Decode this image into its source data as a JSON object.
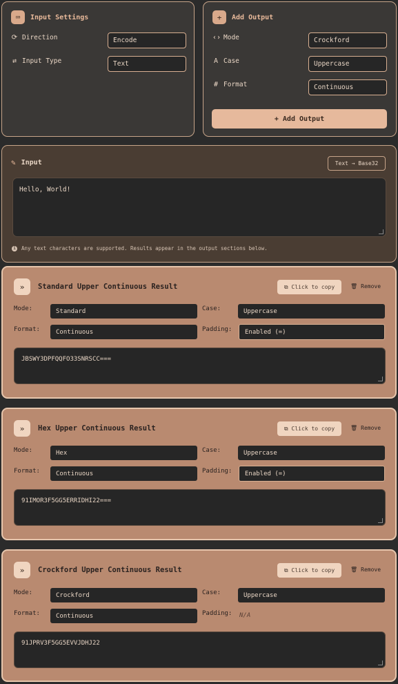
{
  "input_settings": {
    "title": "Input Settings",
    "direction_label": "Direction",
    "direction_value": "Encode",
    "input_type_label": "Input Type",
    "input_type_value": "Text"
  },
  "add_output": {
    "title": "Add Output",
    "mode_label": "Mode",
    "mode_value": "Crockford",
    "case_label": "Case",
    "case_value": "Uppercase",
    "format_label": "Format",
    "format_value": "Continuous",
    "button_label": "Add Output"
  },
  "input": {
    "title": "Input",
    "badge": "Text → Base32",
    "text": "Hello, World!",
    "hint": "Any text characters are supported. Results appear in the output sections below."
  },
  "results": [
    {
      "title": "Standard Upper Continuous Result",
      "copy_label": "Click to copy",
      "remove_label": "Remove",
      "mode_label": "Mode:",
      "mode_value": "Standard",
      "case_label": "Case:",
      "case_value": "Uppercase",
      "format_label": "Format:",
      "format_value": "Continuous",
      "padding_label": "Padding:",
      "padding_value": "Enabled (=)",
      "output": "JBSWY3DPFQQFO33SNRSCC==="
    },
    {
      "title": "Hex Upper Continuous Result",
      "copy_label": "Click to copy",
      "remove_label": "Remove",
      "mode_label": "Mode:",
      "mode_value": "Hex",
      "case_label": "Case:",
      "case_value": "Uppercase",
      "format_label": "Format:",
      "format_value": "Continuous",
      "padding_label": "Padding:",
      "padding_value": "Enabled (=)",
      "output": "91IMOR3F5GG5ERRIDHI22==="
    },
    {
      "title": "Crockford Upper Continuous Result",
      "copy_label": "Click to copy",
      "remove_label": "Remove",
      "mode_label": "Mode:",
      "mode_value": "Crockford",
      "case_label": "Case:",
      "case_value": "Uppercase",
      "format_label": "Format:",
      "format_value": "Continuous",
      "padding_label": "Padding:",
      "padding_value": "N/A",
      "output": "91JPRV3F5GG5EVVJDHJ22"
    }
  ],
  "colors": {
    "accent": "#e6b99c",
    "card": "#b98a70",
    "field": "#262626",
    "border": "#c8a58a"
  }
}
